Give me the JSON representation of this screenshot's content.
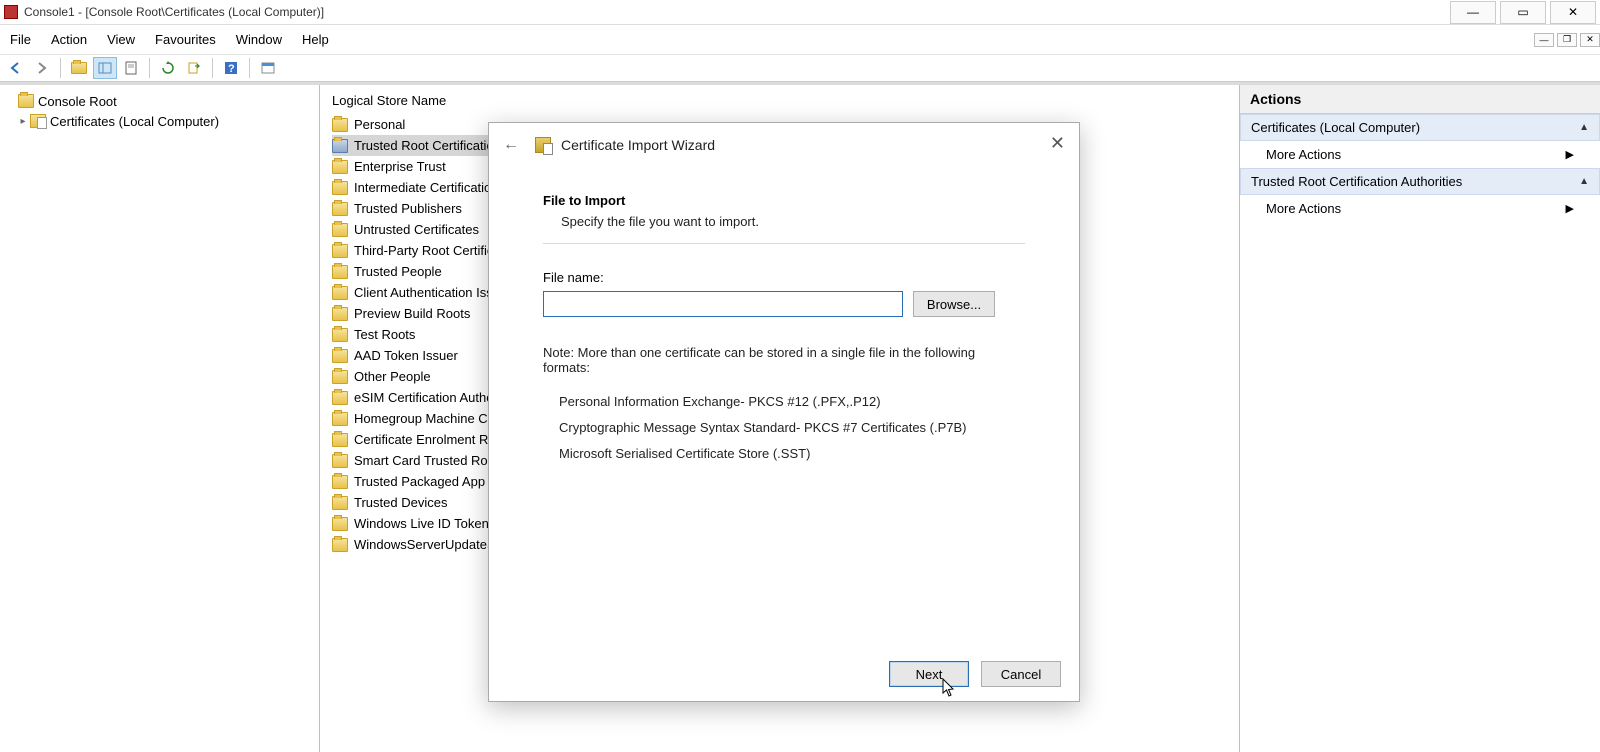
{
  "titlebar": {
    "title": "Console1 - [Console Root\\Certificates (Local Computer)]"
  },
  "menu": {
    "file": "File",
    "action": "Action",
    "view": "View",
    "favourites": "Favourites",
    "window": "Window",
    "help": "Help"
  },
  "tree": {
    "root": "Console Root",
    "child": "Certificates (Local Computer)"
  },
  "mid": {
    "column_header": "Logical Store Name",
    "stores": [
      "Personal",
      "Trusted Root Certification Authorities",
      "Enterprise Trust",
      "Intermediate Certification Authorities",
      "Trusted Publishers",
      "Untrusted Certificates",
      "Third-Party Root Certification Authorities",
      "Trusted People",
      "Client Authentication Issuer",
      "Preview Build Roots",
      "Test Roots",
      "AAD Token Issuer",
      "Other People",
      "eSIM Certification Authorities",
      "Homegroup Machine Certificates",
      "Certificate Enrolment Requests",
      "Smart Card Trusted Roots",
      "Trusted Packaged App Installation",
      "Trusted Devices",
      "Windows Live ID Token Issuer",
      "WindowsServerUpdateServices"
    ],
    "selected_index": 1
  },
  "actions": {
    "header": "Actions",
    "group1": {
      "title": "Certificates (Local Computer)",
      "item": "More Actions"
    },
    "group2": {
      "title": "Trusted Root Certification Authorities",
      "item": "More Actions"
    }
  },
  "dialog": {
    "wizard_title": "Certificate Import Wizard",
    "section_title": "File to Import",
    "section_subtitle": "Specify the file you want to import.",
    "file_label": "File name:",
    "file_value": "",
    "browse": "Browse...",
    "note": "Note:  More than one certificate can be stored in a single file in the following formats:",
    "formats": [
      "Personal Information Exchange- PKCS #12 (.PFX,.P12)",
      "Cryptographic Message Syntax Standard- PKCS #7 Certificates (.P7B)",
      "Microsoft Serialised Certificate Store (.SST)"
    ],
    "next": "Next",
    "cancel": "Cancel"
  }
}
